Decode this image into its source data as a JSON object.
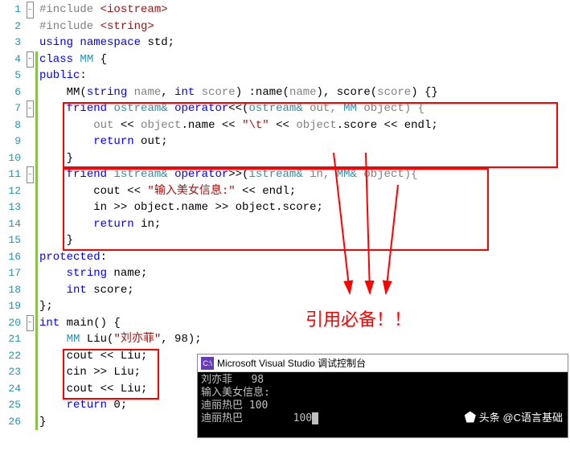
{
  "lines": {
    "l1": {
      "include": "#include ",
      "lib": "<iostream>"
    },
    "l2": {
      "include": "#include ",
      "lib": "<string>"
    },
    "l3": {
      "text": "using namespace std;"
    },
    "l4": {
      "text": "class MM {"
    },
    "l5": {
      "text": "public:"
    },
    "l6": {
      "mm": "MM",
      "args": "(string name, int score) :name(name), score(score) {}"
    },
    "l7": {
      "friend": "friend",
      "ostream": "ostream",
      "amp": "&",
      "opkw": "operator",
      "op": "<<(",
      "otype": "ostream",
      "amp2": "&",
      "out": " out, ",
      "mmtype": "MM",
      "obj": " object) {"
    },
    "l8": {
      "pre": "out << object.name << ",
      "str": "\"\\t\"",
      "post": " << object.score << endl;"
    },
    "l9": {
      "ret": "return",
      "post": " out;"
    },
    "l10": {
      "text": "}"
    },
    "l11": {
      "friend": "friend",
      "istream": "istream",
      "amp": "&",
      "opkw": "operator",
      "op": ">>(",
      "itype": "istream",
      "amp2": "&",
      "in": " in, ",
      "mmtype": "MM",
      "ampobj": "&",
      "obj": " object){"
    },
    "l12": {
      "pre": "cout << ",
      "str": "\"输入美女信息:\"",
      "post": " << endl;"
    },
    "l13": {
      "text": "in >> object.name >> object.score;"
    },
    "l14": {
      "ret": "return",
      "post": " in;"
    },
    "l15": {
      "text": "}"
    },
    "l16": {
      "text": "protected:"
    },
    "l17": {
      "text": "string name;"
    },
    "l18": {
      "kw": "int",
      "post": " score;"
    },
    "l19": {
      "text": "};"
    },
    "l20": {
      "kw": "int",
      "main": " main() {"
    },
    "l21": {
      "mm": "MM",
      "pre": " Liu(",
      "str": "\"刘亦菲\"",
      "post": ", 98);"
    },
    "l22": {
      "text": "cout << Liu;"
    },
    "l23": {
      "text": "cin >> Liu;"
    },
    "l24": {
      "text": "cout << Liu;"
    },
    "l25": {
      "ret": "return",
      "post": " 0;"
    },
    "l26": {
      "text": "}"
    }
  },
  "line_numbers": [
    "1",
    "2",
    "3",
    "4",
    "5",
    "6",
    "7",
    "8",
    "9",
    "10",
    "11",
    "12",
    "13",
    "14",
    "15",
    "16",
    "17",
    "18",
    "19",
    "20",
    "21",
    "22",
    "23",
    "24",
    "25",
    "26"
  ],
  "annotation": "引用必备！！",
  "console": {
    "title": "Microsoft Visual Studio 调试控制台",
    "icon": "C:\\",
    "lines": [
      "刘亦菲   98",
      "输入美女信息:",
      "迪丽热巴 100",
      "迪丽热巴        100"
    ]
  },
  "watermark": "头条 @C语言基础"
}
